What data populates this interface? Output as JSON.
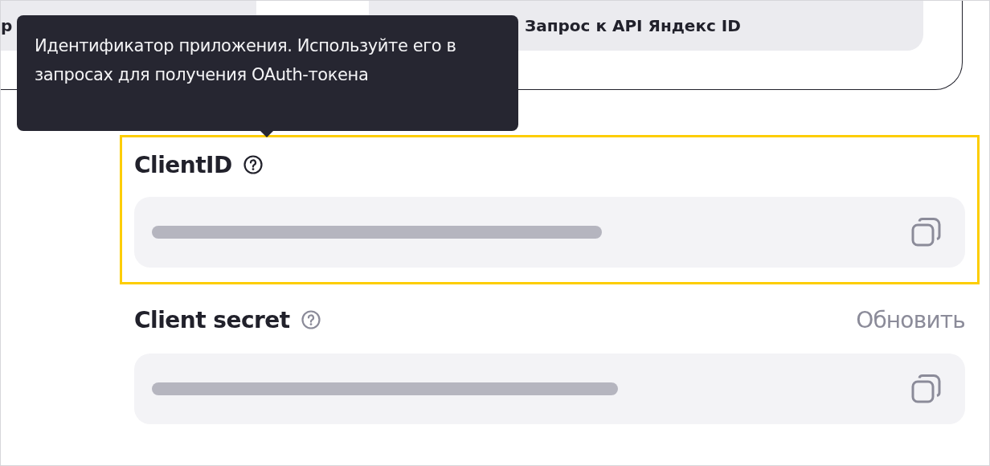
{
  "top_card": {
    "buttons": [
      {
        "label": "р"
      },
      {
        "label": "Запрос к API Яндекс ID"
      }
    ]
  },
  "tooltip": {
    "text": "Идентификатор приложения. Используйте его в запросах для получения OAuth-токена"
  },
  "credentials": [
    {
      "label": "ClientID",
      "highlighted": true
    },
    {
      "label": "Client secret",
      "highlighted": false,
      "action": "Обновить"
    }
  ]
}
